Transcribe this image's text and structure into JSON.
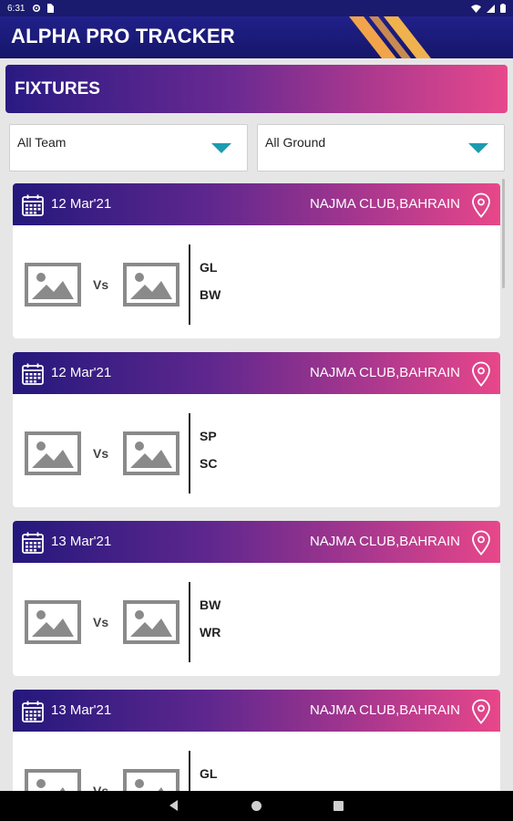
{
  "status_bar": {
    "time": "6:31"
  },
  "app_bar": {
    "title": "ALPHA PRO TRACKER"
  },
  "fixtures": {
    "header": "FIXTURES",
    "filters": {
      "team": "All Team",
      "ground": "All Ground"
    },
    "vs_label": "Vs",
    "matches": [
      {
        "date": "12 Mar'21",
        "venue": "NAJMA CLUB,BAHRAIN",
        "team1": "GL",
        "team2": "BW"
      },
      {
        "date": "12 Mar'21",
        "venue": "NAJMA CLUB,BAHRAIN",
        "team1": "SP",
        "team2": "SC"
      },
      {
        "date": "13 Mar'21",
        "venue": "NAJMA CLUB,BAHRAIN",
        "team1": "BW",
        "team2": "WR"
      },
      {
        "date": "13 Mar'21",
        "venue": "NAJMA CLUB,BAHRAIN",
        "team1": "GL",
        "team2": ""
      }
    ]
  },
  "colors": {
    "header_gradient_start": "#24187c",
    "header_gradient_end": "#e8478a",
    "dropdown_caret": "#1e9bb0",
    "app_bar": "#1a1a6e"
  }
}
